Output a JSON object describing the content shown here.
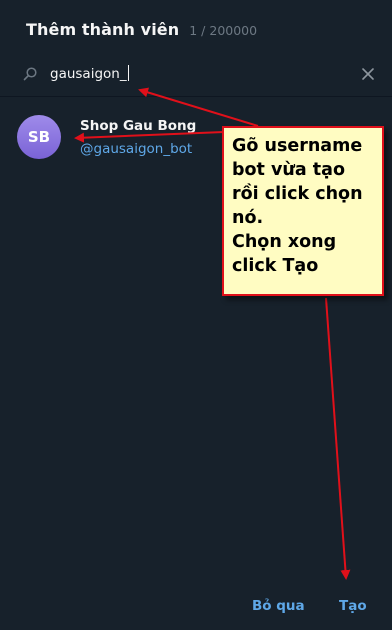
{
  "dialog": {
    "title": "Thêm thành viên",
    "member_count": "1 / 200000"
  },
  "search": {
    "icon": "search-icon",
    "value": "gausaigon_",
    "clear_icon": "close-icon"
  },
  "results": [
    {
      "initials": "SB",
      "name": "Shop Gau Bong",
      "username": "@gausaigon_bot",
      "avatar_color": "#8a74e0"
    }
  ],
  "annotation": {
    "lines": [
      "Gõ username",
      "bot vừa tạo",
      "rồi click chọn",
      "nó.",
      "Chọn xong",
      "click Tạo"
    ],
    "background": "#fffcc2",
    "border_color": "#e0101a"
  },
  "buttons": {
    "cancel": "Bỏ qua",
    "create": "Tạo"
  },
  "colors": {
    "background": "#17212b",
    "accent": "#5fa8e8",
    "arrow": "#e0101a"
  }
}
